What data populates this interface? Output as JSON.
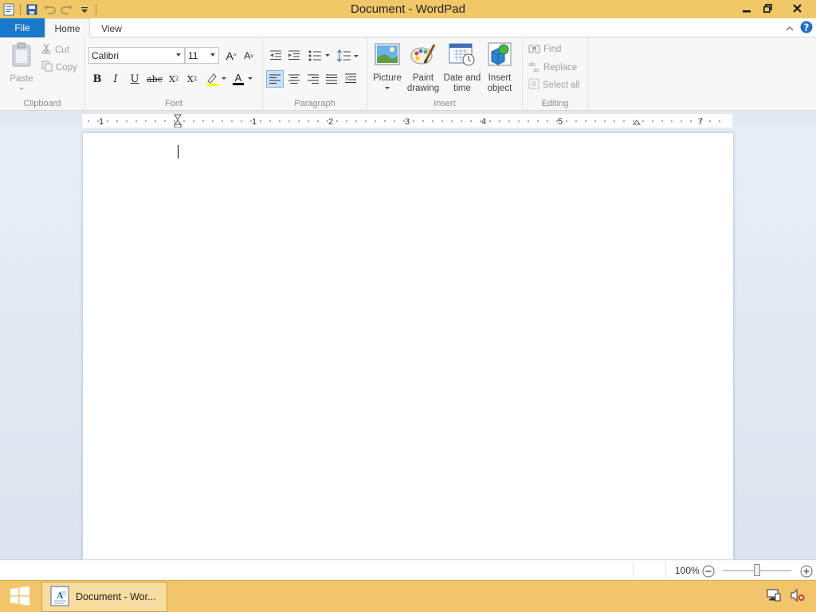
{
  "window": {
    "title": "Document - WordPad"
  },
  "tabs": {
    "file": "File",
    "home": "Home",
    "view": "View"
  },
  "clipboard": {
    "label": "Clipboard",
    "paste": "Paste",
    "cut": "Cut",
    "copy": "Copy"
  },
  "font": {
    "label": "Font",
    "family": "Calibri",
    "size": "11"
  },
  "paragraph": {
    "label": "Paragraph"
  },
  "insert": {
    "label": "Insert",
    "picture": "Picture",
    "paint_line1": "Paint",
    "paint_line2": "drawing",
    "date_line1": "Date and",
    "date_line2": "time",
    "object_line1": "Insert",
    "object_line2": "object"
  },
  "editing": {
    "label": "Editing",
    "find": "Find",
    "replace": "Replace",
    "select_all": "Select all"
  },
  "ruler": {
    "numbers": [
      "1",
      "1",
      "2",
      "3",
      "4",
      "5",
      "7"
    ]
  },
  "status": {
    "zoom": "100%"
  },
  "taskbar": {
    "item": "Document - Wor..."
  },
  "colors": {
    "titlebar": "#f0c868",
    "file_tab": "#1979ca",
    "taskbar": "#f2c56c",
    "font_color_bar": "#000000",
    "highlight_bar": "#ffff00"
  },
  "icons": [
    "wordpad-app-icon",
    "save-icon",
    "undo-icon",
    "redo-icon",
    "customize-qat-icon",
    "minimize-icon",
    "restore-icon",
    "close-icon",
    "ribbon-collapse-icon",
    "help-icon",
    "paste-icon",
    "cut-icon",
    "copy-icon",
    "grow-font-icon",
    "shrink-font-icon",
    "bold-icon",
    "italic-icon",
    "underline-icon",
    "strikethrough-icon",
    "subscript-icon",
    "superscript-icon",
    "highlight-icon",
    "font-color-icon",
    "decrease-indent-icon",
    "increase-indent-icon",
    "bullets-icon",
    "line-spacing-icon",
    "align-left-icon",
    "align-center-icon",
    "align-right-icon",
    "justify-icon",
    "paragraph-icon",
    "picture-icon",
    "paint-drawing-icon",
    "date-time-icon",
    "insert-object-icon",
    "find-icon",
    "replace-icon",
    "select-all-icon",
    "zoom-out-icon",
    "zoom-in-icon",
    "start-icon",
    "network-icon",
    "volume-muted-icon"
  ]
}
